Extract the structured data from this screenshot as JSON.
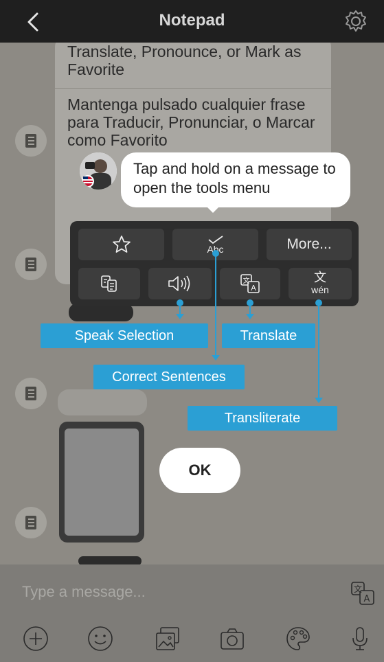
{
  "header": {
    "title": "Notepad"
  },
  "messages": {
    "english_partial": "Translate, Pronounce, or Mark as Favorite",
    "spanish": "Mantenga pulsado cualquier frase para Traducir, Pronunciar, o Marcar como Favorito"
  },
  "hint": {
    "text": "Tap and hold on a message to open the tools menu"
  },
  "menu": {
    "favorite_icon": "star-icon",
    "correct_label": "Abc",
    "more_label": "More...",
    "transliterate_top": "文",
    "transliterate_bottom": "wén"
  },
  "callouts": {
    "speak": "Speak Selection",
    "translate": "Translate",
    "correct": "Correct Sentences",
    "transliterate": "Transliterate"
  },
  "ok_label": "OK",
  "composer": {
    "placeholder": "Type a message...",
    "tools": [
      "plus-icon",
      "emoji-icon",
      "gallery-icon",
      "camera-icon",
      "palette-icon",
      "microphone-icon"
    ]
  },
  "colors": {
    "accent": "#2b9fd4",
    "header_bg": "#1f1f1f",
    "menu_bg": "#2d2d2d"
  }
}
